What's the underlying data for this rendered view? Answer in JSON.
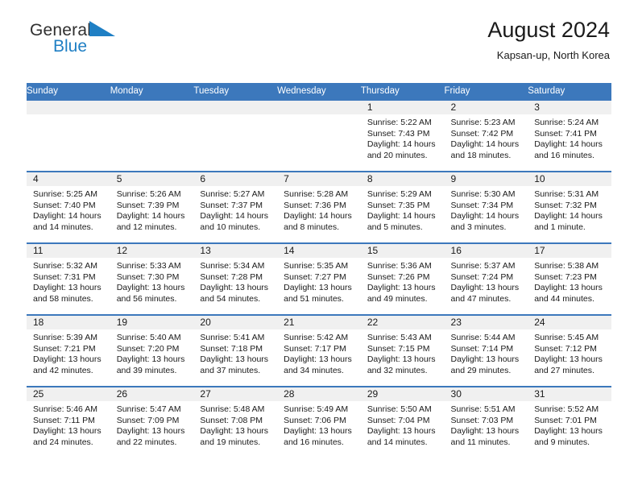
{
  "logo": {
    "word_one": "General",
    "word_two": "Blue",
    "accent_color": "#1f7fc4",
    "triangle_icon": "blue-triangle-icon"
  },
  "header": {
    "title": "August 2024",
    "subtitle": "Kapsan-up, North Korea"
  },
  "calendar": {
    "header_color": "#3c78bc",
    "weekdays": [
      "Sunday",
      "Monday",
      "Tuesday",
      "Wednesday",
      "Thursday",
      "Friday",
      "Saturday"
    ],
    "labels": {
      "sunrise": "Sunrise:",
      "sunset": "Sunset:",
      "daylight": "Daylight:"
    },
    "weeks": [
      [
        {
          "day": "",
          "sunrise": "",
          "sunset": "",
          "daylight_line1": "",
          "daylight_line2": ""
        },
        {
          "day": "",
          "sunrise": "",
          "sunset": "",
          "daylight_line1": "",
          "daylight_line2": ""
        },
        {
          "day": "",
          "sunrise": "",
          "sunset": "",
          "daylight_line1": "",
          "daylight_line2": ""
        },
        {
          "day": "",
          "sunrise": "",
          "sunset": "",
          "daylight_line1": "",
          "daylight_line2": ""
        },
        {
          "day": "1",
          "sunrise": "Sunrise: 5:22 AM",
          "sunset": "Sunset: 7:43 PM",
          "daylight_line1": "Daylight: 14 hours",
          "daylight_line2": "and 20 minutes."
        },
        {
          "day": "2",
          "sunrise": "Sunrise: 5:23 AM",
          "sunset": "Sunset: 7:42 PM",
          "daylight_line1": "Daylight: 14 hours",
          "daylight_line2": "and 18 minutes."
        },
        {
          "day": "3",
          "sunrise": "Sunrise: 5:24 AM",
          "sunset": "Sunset: 7:41 PM",
          "daylight_line1": "Daylight: 14 hours",
          "daylight_line2": "and 16 minutes."
        }
      ],
      [
        {
          "day": "4",
          "sunrise": "Sunrise: 5:25 AM",
          "sunset": "Sunset: 7:40 PM",
          "daylight_line1": "Daylight: 14 hours",
          "daylight_line2": "and 14 minutes."
        },
        {
          "day": "5",
          "sunrise": "Sunrise: 5:26 AM",
          "sunset": "Sunset: 7:39 PM",
          "daylight_line1": "Daylight: 14 hours",
          "daylight_line2": "and 12 minutes."
        },
        {
          "day": "6",
          "sunrise": "Sunrise: 5:27 AM",
          "sunset": "Sunset: 7:37 PM",
          "daylight_line1": "Daylight: 14 hours",
          "daylight_line2": "and 10 minutes."
        },
        {
          "day": "7",
          "sunrise": "Sunrise: 5:28 AM",
          "sunset": "Sunset: 7:36 PM",
          "daylight_line1": "Daylight: 14 hours",
          "daylight_line2": "and 8 minutes."
        },
        {
          "day": "8",
          "sunrise": "Sunrise: 5:29 AM",
          "sunset": "Sunset: 7:35 PM",
          "daylight_line1": "Daylight: 14 hours",
          "daylight_line2": "and 5 minutes."
        },
        {
          "day": "9",
          "sunrise": "Sunrise: 5:30 AM",
          "sunset": "Sunset: 7:34 PM",
          "daylight_line1": "Daylight: 14 hours",
          "daylight_line2": "and 3 minutes."
        },
        {
          "day": "10",
          "sunrise": "Sunrise: 5:31 AM",
          "sunset": "Sunset: 7:32 PM",
          "daylight_line1": "Daylight: 14 hours",
          "daylight_line2": "and 1 minute."
        }
      ],
      [
        {
          "day": "11",
          "sunrise": "Sunrise: 5:32 AM",
          "sunset": "Sunset: 7:31 PM",
          "daylight_line1": "Daylight: 13 hours",
          "daylight_line2": "and 58 minutes."
        },
        {
          "day": "12",
          "sunrise": "Sunrise: 5:33 AM",
          "sunset": "Sunset: 7:30 PM",
          "daylight_line1": "Daylight: 13 hours",
          "daylight_line2": "and 56 minutes."
        },
        {
          "day": "13",
          "sunrise": "Sunrise: 5:34 AM",
          "sunset": "Sunset: 7:28 PM",
          "daylight_line1": "Daylight: 13 hours",
          "daylight_line2": "and 54 minutes."
        },
        {
          "day": "14",
          "sunrise": "Sunrise: 5:35 AM",
          "sunset": "Sunset: 7:27 PM",
          "daylight_line1": "Daylight: 13 hours",
          "daylight_line2": "and 51 minutes."
        },
        {
          "day": "15",
          "sunrise": "Sunrise: 5:36 AM",
          "sunset": "Sunset: 7:26 PM",
          "daylight_line1": "Daylight: 13 hours",
          "daylight_line2": "and 49 minutes."
        },
        {
          "day": "16",
          "sunrise": "Sunrise: 5:37 AM",
          "sunset": "Sunset: 7:24 PM",
          "daylight_line1": "Daylight: 13 hours",
          "daylight_line2": "and 47 minutes."
        },
        {
          "day": "17",
          "sunrise": "Sunrise: 5:38 AM",
          "sunset": "Sunset: 7:23 PM",
          "daylight_line1": "Daylight: 13 hours",
          "daylight_line2": "and 44 minutes."
        }
      ],
      [
        {
          "day": "18",
          "sunrise": "Sunrise: 5:39 AM",
          "sunset": "Sunset: 7:21 PM",
          "daylight_line1": "Daylight: 13 hours",
          "daylight_line2": "and 42 minutes."
        },
        {
          "day": "19",
          "sunrise": "Sunrise: 5:40 AM",
          "sunset": "Sunset: 7:20 PM",
          "daylight_line1": "Daylight: 13 hours",
          "daylight_line2": "and 39 minutes."
        },
        {
          "day": "20",
          "sunrise": "Sunrise: 5:41 AM",
          "sunset": "Sunset: 7:18 PM",
          "daylight_line1": "Daylight: 13 hours",
          "daylight_line2": "and 37 minutes."
        },
        {
          "day": "21",
          "sunrise": "Sunrise: 5:42 AM",
          "sunset": "Sunset: 7:17 PM",
          "daylight_line1": "Daylight: 13 hours",
          "daylight_line2": "and 34 minutes."
        },
        {
          "day": "22",
          "sunrise": "Sunrise: 5:43 AM",
          "sunset": "Sunset: 7:15 PM",
          "daylight_line1": "Daylight: 13 hours",
          "daylight_line2": "and 32 minutes."
        },
        {
          "day": "23",
          "sunrise": "Sunrise: 5:44 AM",
          "sunset": "Sunset: 7:14 PM",
          "daylight_line1": "Daylight: 13 hours",
          "daylight_line2": "and 29 minutes."
        },
        {
          "day": "24",
          "sunrise": "Sunrise: 5:45 AM",
          "sunset": "Sunset: 7:12 PM",
          "daylight_line1": "Daylight: 13 hours",
          "daylight_line2": "and 27 minutes."
        }
      ],
      [
        {
          "day": "25",
          "sunrise": "Sunrise: 5:46 AM",
          "sunset": "Sunset: 7:11 PM",
          "daylight_line1": "Daylight: 13 hours",
          "daylight_line2": "and 24 minutes."
        },
        {
          "day": "26",
          "sunrise": "Sunrise: 5:47 AM",
          "sunset": "Sunset: 7:09 PM",
          "daylight_line1": "Daylight: 13 hours",
          "daylight_line2": "and 22 minutes."
        },
        {
          "day": "27",
          "sunrise": "Sunrise: 5:48 AM",
          "sunset": "Sunset: 7:08 PM",
          "daylight_line1": "Daylight: 13 hours",
          "daylight_line2": "and 19 minutes."
        },
        {
          "day": "28",
          "sunrise": "Sunrise: 5:49 AM",
          "sunset": "Sunset: 7:06 PM",
          "daylight_line1": "Daylight: 13 hours",
          "daylight_line2": "and 16 minutes."
        },
        {
          "day": "29",
          "sunrise": "Sunrise: 5:50 AM",
          "sunset": "Sunset: 7:04 PM",
          "daylight_line1": "Daylight: 13 hours",
          "daylight_line2": "and 14 minutes."
        },
        {
          "day": "30",
          "sunrise": "Sunrise: 5:51 AM",
          "sunset": "Sunset: 7:03 PM",
          "daylight_line1": "Daylight: 13 hours",
          "daylight_line2": "and 11 minutes."
        },
        {
          "day": "31",
          "sunrise": "Sunrise: 5:52 AM",
          "sunset": "Sunset: 7:01 PM",
          "daylight_line1": "Daylight: 13 hours",
          "daylight_line2": "and 9 minutes."
        }
      ]
    ]
  }
}
